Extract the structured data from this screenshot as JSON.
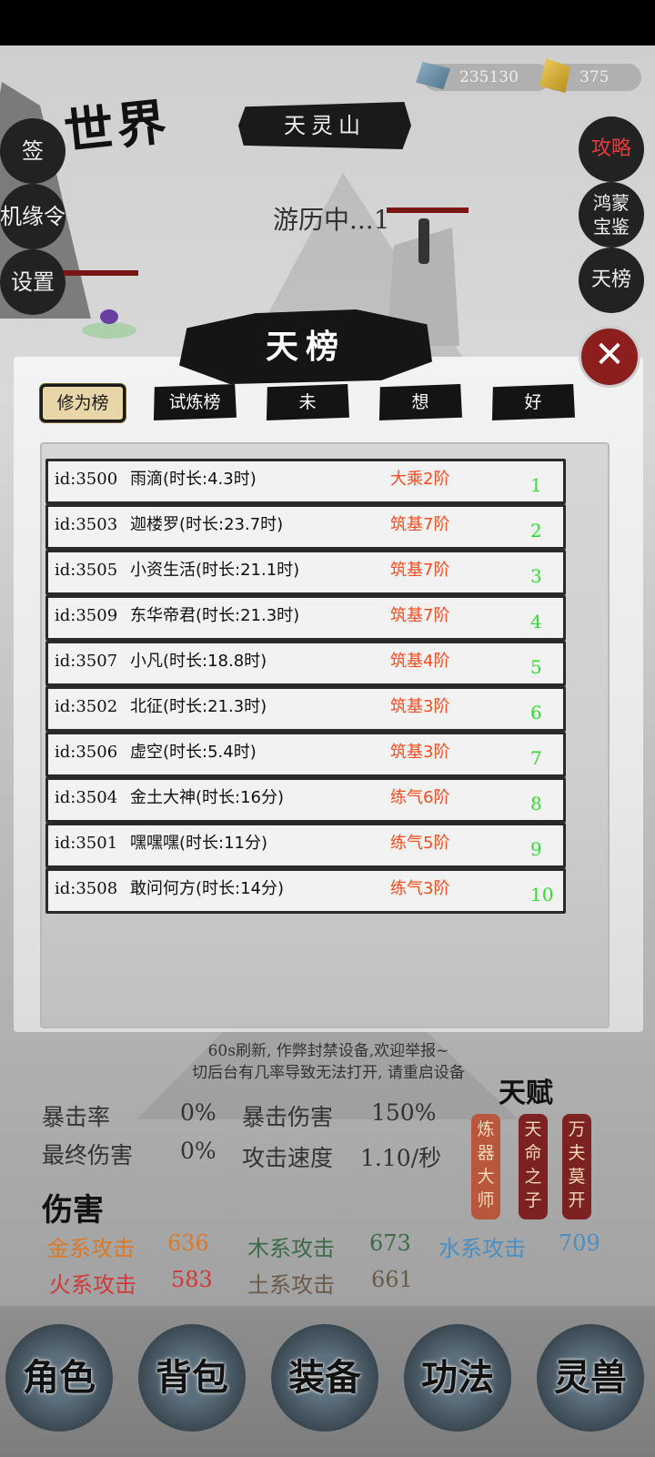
{
  "header": {
    "world_title": "世界",
    "location": "天灵山",
    "spirit_stones": "235130",
    "gold": "375"
  },
  "left_menu": [
    "签",
    "机缘令",
    "设置"
  ],
  "right_menu": [
    "攻略",
    "鸿蒙宝鉴",
    "天榜"
  ],
  "scene": {
    "status_text": "游历中...1"
  },
  "modal": {
    "title": "天榜",
    "tabs": [
      "修为榜",
      "试炼榜",
      "未",
      "想",
      "好"
    ],
    "rows": [
      {
        "id": "id:3500",
        "name": "雨滴(时长:4.3时)",
        "rank": "大乘2阶",
        "pos": "1"
      },
      {
        "id": "id:3503",
        "name": "迦楼罗(时长:23.7时)",
        "rank": "筑基7阶",
        "pos": "2"
      },
      {
        "id": "id:3505",
        "name": "小资生活(时长:21.1时)",
        "rank": "筑基7阶",
        "pos": "3"
      },
      {
        "id": "id:3509",
        "name": "东华帝君(时长:21.3时)",
        "rank": "筑基7阶",
        "pos": "4"
      },
      {
        "id": "id:3507",
        "name": "小凡(时长:18.8时)",
        "rank": "筑基4阶",
        "pos": "5"
      },
      {
        "id": "id:3502",
        "name": "北征(时长:21.3时)",
        "rank": "筑基3阶",
        "pos": "6"
      },
      {
        "id": "id:3506",
        "name": "虚空(时长:5.4时)",
        "rank": "筑基3阶",
        "pos": "7"
      },
      {
        "id": "id:3504",
        "name": "金土大神(时长:16分)",
        "rank": "练气6阶",
        "pos": "8"
      },
      {
        "id": "id:3501",
        "name": "嘿嘿嘿(时长:11分)",
        "rank": "练气5阶",
        "pos": "9"
      },
      {
        "id": "id:3508",
        "name": "敢问何方(时长:14分)",
        "rank": "练气3阶",
        "pos": "10"
      }
    ],
    "footer_line1": "60s刷新, 作弊封禁设备,欢迎举报~",
    "footer_line2": "切后台有几率导致无法打开, 请重启设备"
  },
  "stats": {
    "crit_rate_label": "暴击率",
    "crit_rate": "0%",
    "crit_damage_label": "暴击伤害",
    "crit_damage": "150%",
    "final_damage_label": "最终伤害",
    "final_damage": "0%",
    "attack_speed_label": "攻击速度",
    "attack_speed": "1.10/秒"
  },
  "talents": {
    "title": "天赋",
    "items": [
      "炼器大师",
      "天命之子",
      "万夫莫开"
    ]
  },
  "damage": {
    "title": "伤害",
    "metal_label": "金系攻击",
    "metal": "636",
    "wood_label": "木系攻击",
    "wood": "673",
    "water_label": "水系攻击",
    "water": "709",
    "fire_label": "火系攻击",
    "fire": "583",
    "earth_label": "土系攻击",
    "earth": "661"
  },
  "nav": [
    "角色",
    "背包",
    "装备",
    "功法",
    "灵兽"
  ],
  "colors": {
    "rank_red": "#ff4a1c",
    "pos_green": "#2ee02e",
    "metal": "#d97a2b",
    "wood": "#3d6b4a",
    "water": "#4a8fc4",
    "fire": "#d13a3a",
    "earth": "#6a5a4a"
  }
}
